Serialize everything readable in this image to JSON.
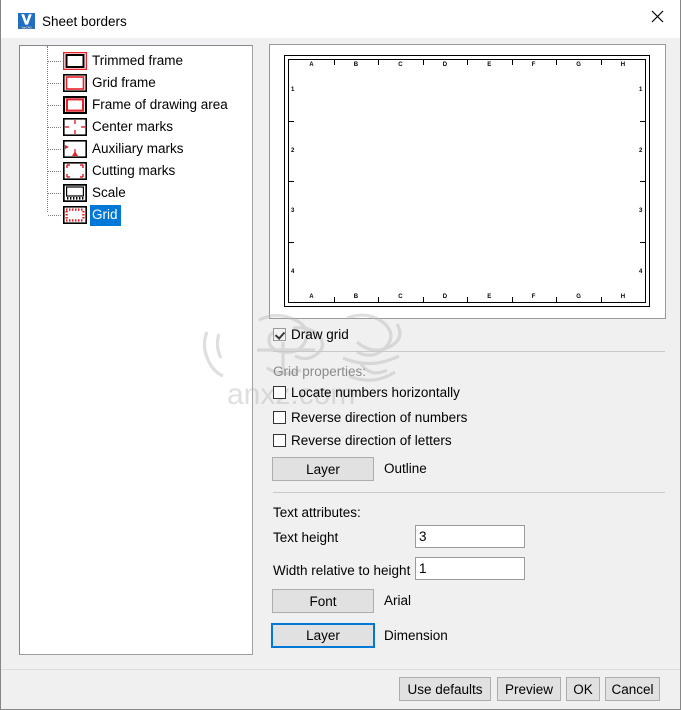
{
  "window": {
    "title": "Sheet borders",
    "app_icon": "varicad-logo-icon",
    "close_label": "✕"
  },
  "tree": {
    "items": [
      {
        "label": "Trimmed frame",
        "icon": "trimmed-frame-icon",
        "selected": false
      },
      {
        "label": "Grid frame",
        "icon": "grid-frame-icon",
        "selected": false
      },
      {
        "label": "Frame of drawing area",
        "icon": "drawing-area-frame-icon",
        "selected": false
      },
      {
        "label": "Center marks",
        "icon": "center-marks-icon",
        "selected": false
      },
      {
        "label": "Auxiliary marks",
        "icon": "auxiliary-marks-icon",
        "selected": false
      },
      {
        "label": "Cutting marks",
        "icon": "cutting-marks-icon",
        "selected": false
      },
      {
        "label": "Scale",
        "icon": "scale-icon",
        "selected": false
      },
      {
        "label": "Grid",
        "icon": "grid-icon",
        "selected": true
      }
    ]
  },
  "preview": {
    "column_labels": [
      "A",
      "B",
      "C",
      "D",
      "E",
      "F",
      "G",
      "H"
    ],
    "row_labels": [
      "1",
      "2",
      "3",
      "4"
    ]
  },
  "options": {
    "draw_grid": {
      "label": "Draw grid",
      "checked": true,
      "enabled": false
    },
    "group_label": "Grid properties:",
    "locate_numbers_horizontally": {
      "label": "Locate numbers horizontally",
      "checked": false
    },
    "reverse_direction_of_numbers": {
      "label": "Reverse direction of numbers",
      "checked": false
    },
    "reverse_direction_of_letters": {
      "label": "Reverse direction of letters",
      "checked": false
    },
    "grid_layer_button": "Layer",
    "grid_layer_value": "Outline"
  },
  "text_attributes": {
    "group_label": "Text attributes:",
    "text_height_label": "Text height",
    "text_height_value": "3",
    "width_relative_label": "Width relative to height",
    "width_relative_value": "1",
    "font_button": "Font",
    "font_value": "Arial",
    "layer_button": "Layer",
    "layer_value": "Dimension"
  },
  "footer": {
    "use_defaults": "Use defaults",
    "preview": "Preview",
    "ok": "OK",
    "cancel": "Cancel"
  },
  "watermark": {
    "text": "anxz.com"
  },
  "colors": {
    "dialog_bg": "#f0f0f0",
    "accent_blue": "#0078d7",
    "icon_red": "#e8212a",
    "field_bg": "#ffffff"
  }
}
